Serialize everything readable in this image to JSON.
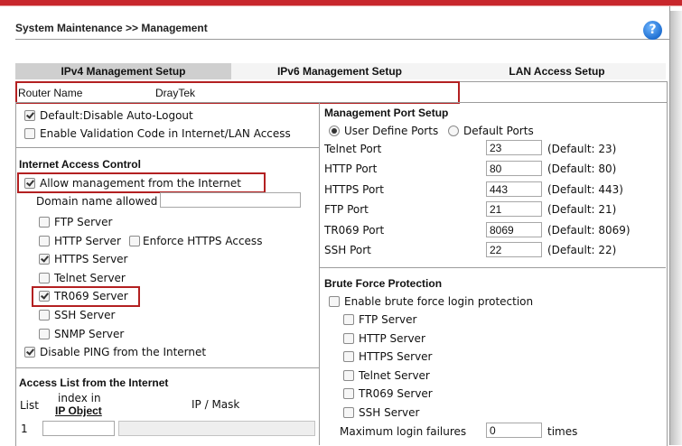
{
  "header": {
    "title": "System Maintenance >> Management",
    "help_icon": "?"
  },
  "tabs": [
    {
      "label": "IPv4 Management Setup",
      "active": true
    },
    {
      "label": "IPv6 Management Setup",
      "active": false
    },
    {
      "label": "LAN Access Setup",
      "active": false
    }
  ],
  "router": {
    "label": "Router Name",
    "value": "DrayTek"
  },
  "left": {
    "auto_logout": {
      "label": "Default:Disable Auto-Logout",
      "checked": true
    },
    "validation_code": {
      "label": "Enable Validation Code in Internet/LAN Access",
      "checked": false
    },
    "internet_access_title": "Internet Access Control",
    "allow_mgmt": {
      "label": "Allow management from the Internet",
      "checked": true
    },
    "domain_label": "Domain name allowed",
    "domain_value": "",
    "servers": [
      {
        "label": "FTP Server",
        "checked": false
      },
      {
        "label": "HTTP Server",
        "checked": false
      },
      {
        "label": "HTTPS Server",
        "checked": true
      },
      {
        "label": "Telnet Server",
        "checked": false
      },
      {
        "label": "TR069 Server",
        "checked": true
      },
      {
        "label": "SSH Server",
        "checked": false
      },
      {
        "label": "SNMP Server",
        "checked": false
      }
    ],
    "enforce_https": {
      "label": "Enforce HTTPS Access",
      "checked": false
    },
    "disable_ping": {
      "label": "Disable PING from the Internet",
      "checked": true
    },
    "access_list_title": "Access List from the Internet",
    "access_list": {
      "col_list": "List",
      "col_index_1": "index in",
      "col_index_2": "IP Object",
      "col_ipmask": "IP / Mask",
      "row1": "1"
    }
  },
  "right": {
    "mgmt_port_title": "Management Port Setup",
    "user_define": {
      "label": "User Define Ports",
      "selected": true
    },
    "default_ports": {
      "label": "Default Ports",
      "selected": false
    },
    "ports": [
      {
        "label": "Telnet Port",
        "value": "23",
        "default": "(Default: 23)"
      },
      {
        "label": "HTTP Port",
        "value": "80",
        "default": "(Default: 80)"
      },
      {
        "label": "HTTPS Port",
        "value": "443",
        "default": "(Default: 443)"
      },
      {
        "label": "FTP Port",
        "value": "21",
        "default": "(Default: 21)"
      },
      {
        "label": "TR069 Port",
        "value": "8069",
        "default": "(Default: 8069)"
      },
      {
        "label": "SSH Port",
        "value": "22",
        "default": "(Default: 22)"
      }
    ],
    "brute_title": "Brute Force Protection",
    "brute_enable": {
      "label": "Enable brute force login protection",
      "checked": false
    },
    "brute_servers": [
      {
        "label": "FTP Server",
        "checked": false
      },
      {
        "label": "HTTP Server",
        "checked": false
      },
      {
        "label": "HTTPS Server",
        "checked": false
      },
      {
        "label": "Telnet Server",
        "checked": false
      },
      {
        "label": "TR069 Server",
        "checked": false
      },
      {
        "label": "SSH Server",
        "checked": false
      }
    ],
    "max_failures": {
      "label": "Maximum login failures",
      "value": "0",
      "unit": "times"
    }
  }
}
